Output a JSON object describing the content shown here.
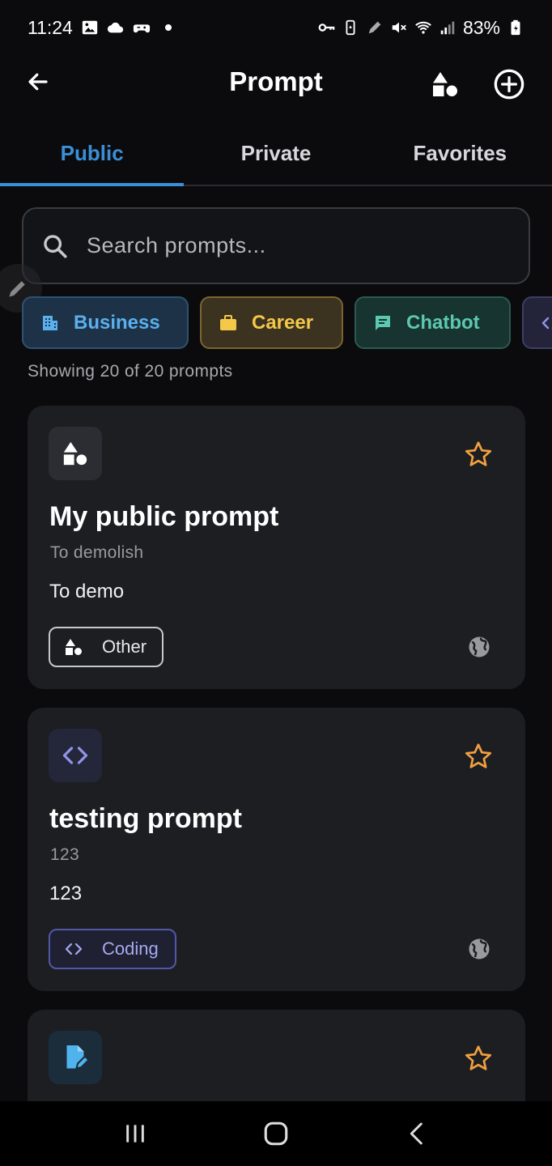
{
  "status_bar": {
    "time": "11:24",
    "battery": "83%"
  },
  "app_bar": {
    "title": "Prompt"
  },
  "tabs": [
    {
      "label": "Public",
      "active": true
    },
    {
      "label": "Private",
      "active": false
    },
    {
      "label": "Favorites",
      "active": false
    }
  ],
  "search": {
    "placeholder": "Search prompts...",
    "value": ""
  },
  "categories": [
    {
      "label": "Business",
      "icon": "building-icon",
      "color": "#5ab0ee"
    },
    {
      "label": "Career",
      "icon": "briefcase-icon",
      "color": "#f5c84a"
    },
    {
      "label": "Chatbot",
      "icon": "chat-icon",
      "color": "#5cc8b0"
    },
    {
      "label": "",
      "icon": "code-icon",
      "color": "#8f94e8"
    }
  ],
  "results": {
    "count_text": "Showing 20 of 20 prompts"
  },
  "prompts": [
    {
      "icon": "shapes-icon",
      "title": "My public prompt",
      "subtitle": "To demolish",
      "description": "To demo",
      "category": "Other",
      "favorite": false,
      "visibility": "public"
    },
    {
      "icon": "code-icon",
      "title": "testing prompt",
      "subtitle": "123",
      "description": "123",
      "category": "Coding",
      "favorite": false,
      "visibility": "public"
    },
    {
      "icon": "edit-document-icon",
      "favorite": false
    }
  ],
  "colors": {
    "accent": "#3a8fd8",
    "star": "#f0a040",
    "background": "#0b0b0d",
    "card": "#1d1e22"
  }
}
